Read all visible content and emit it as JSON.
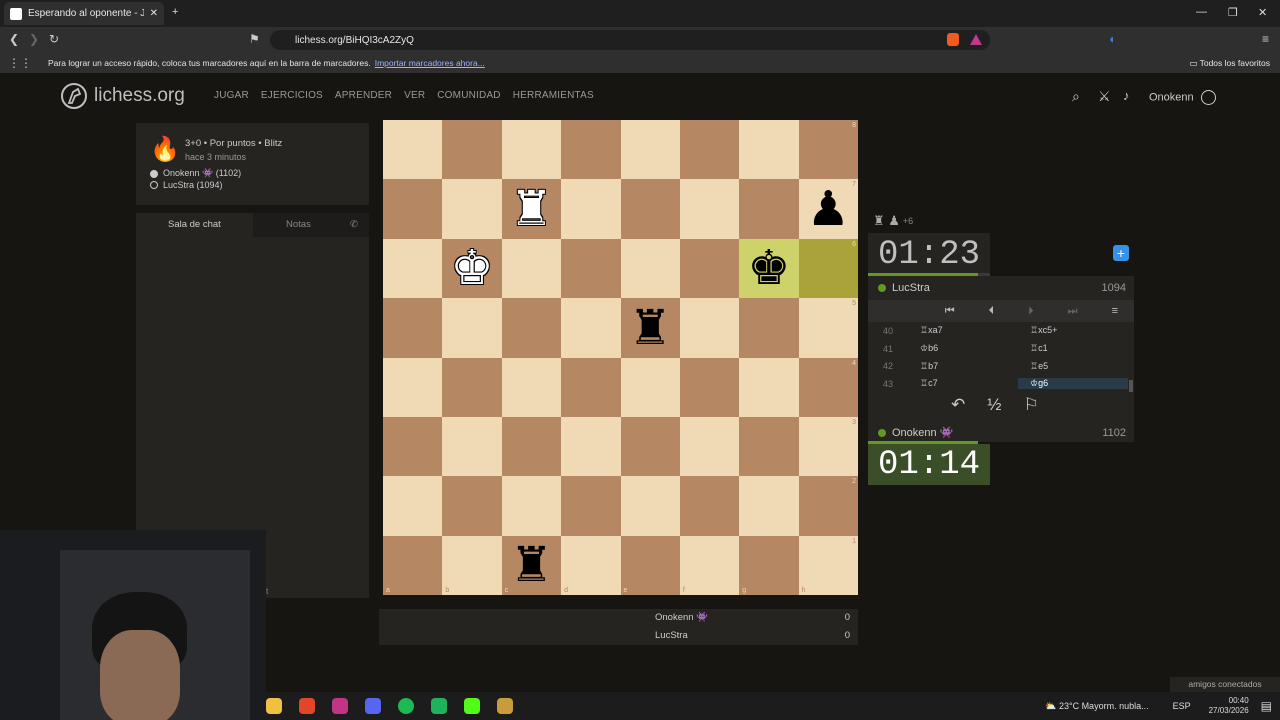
{
  "browser": {
    "tab_title": "Esperando al oponente - Jug",
    "new_tab": "+",
    "url": "lichess.org/BiHQI3cA2ZyQ",
    "bookmarks_msg": "Para lograr un acceso rápido, coloca tus marcadores aquí en la barra de marcadores.",
    "bookmarks_link": "Importar marcadores ahora...",
    "all_favorites": "Todos los favoritos",
    "win_min": "—",
    "win_max": "❐",
    "win_close": "✕"
  },
  "site": {
    "logo": "lichess.org",
    "nav": [
      "JUGAR",
      "EJERCICIOS",
      "APRENDER",
      "VER",
      "COMUNIDAD",
      "HERRAMIENTAS"
    ],
    "user": "Onokenn"
  },
  "game": {
    "info": "3+0 • Por puntos • Blitz",
    "time_ago": "hace 3 minutos",
    "player_white": "Onokenn 👾 (1102)",
    "player_black": "LucStra (1094)"
  },
  "chat": {
    "tab_chat": "Sala de chat",
    "tab_notes": "Notas",
    "partial": "t"
  },
  "board": {
    "files": [
      "a",
      "b",
      "c",
      "d",
      "e",
      "f",
      "g",
      "h"
    ],
    "ranks": [
      "8",
      "7",
      "6",
      "5",
      "4",
      "3",
      "2",
      "1"
    ],
    "pieces": [
      {
        "square": "c7",
        "glyph": "♜",
        "color": "white"
      },
      {
        "square": "h7",
        "glyph": "♟",
        "color": "black"
      },
      {
        "square": "b6",
        "glyph": "♚",
        "color": "white"
      },
      {
        "square": "g6",
        "glyph": "♚",
        "color": "black"
      },
      {
        "square": "e5",
        "glyph": "♜",
        "color": "black"
      },
      {
        "square": "c1",
        "glyph": "♜",
        "color": "black"
      }
    ],
    "highlight": [
      "g6",
      "h6"
    ]
  },
  "opponent": {
    "name": "LucStra",
    "rating": "1094",
    "clock": "01:23",
    "captured": "♜ ♟",
    "material": "+6",
    "time_fraction": 0.9
  },
  "me": {
    "name": "Onokenn 👾",
    "rating": "1102",
    "clock": "01:14",
    "time_fraction": 0.9
  },
  "moves": [
    {
      "n": "40",
      "w": "♖xa7",
      "b": "♖xc5+"
    },
    {
      "n": "41",
      "w": "♔b6",
      "b": "♖c1"
    },
    {
      "n": "42",
      "w": "♖b7",
      "b": "♖e5"
    },
    {
      "n": "43",
      "w": "♖c7",
      "b": "♔g6"
    }
  ],
  "controls": {
    "first": "⏮",
    "prev": "⏴",
    "next": "⏵",
    "last": "⏭",
    "menu": "≡",
    "takeback": "↶",
    "draw": "½",
    "resign": "⚐"
  },
  "score": [
    {
      "name": "Onokenn 👾",
      "value": "0"
    },
    {
      "name": "LucStra",
      "value": "0"
    }
  ],
  "friends": "amigos conectados",
  "taskbar": {
    "weather": "23°C  Mayorm. nubla...",
    "lang": "ESP",
    "time": "00:40",
    "date": "27/03/2026"
  },
  "colors": {
    "green": "#629924",
    "board_light": "#f0d9b5",
    "board_dark": "#b58863"
  }
}
